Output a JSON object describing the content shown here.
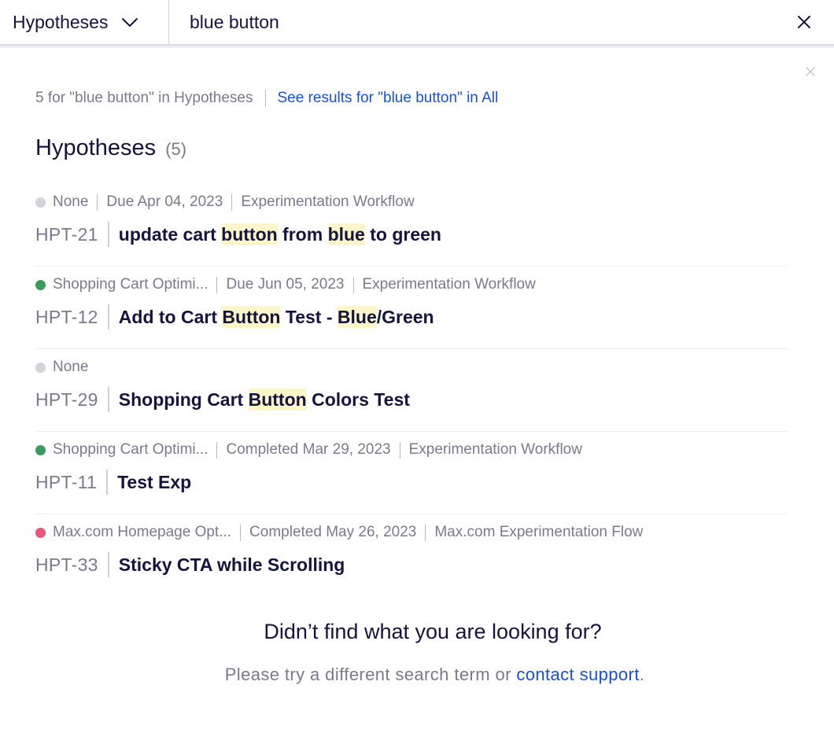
{
  "search": {
    "scope_label": "Hypotheses",
    "query": "blue button",
    "icons": {
      "scope_toggle": "chevron-down-icon",
      "clear": "close-icon"
    }
  },
  "panel": {
    "close_icon": "close-icon",
    "summary": "5 for \"blue button\" in Hypotheses",
    "see_all_link": "See results for \"blue button\" in All",
    "section_title": "Hypotheses",
    "section_count": "(5)"
  },
  "results": [
    {
      "status_color": "#d3d3d9",
      "meta": [
        "None",
        "Due Apr 04, 2023",
        "Experimentation Workflow"
      ],
      "id": "HPT-21",
      "title_parts": [
        {
          "text": "update cart ",
          "hl": false
        },
        {
          "text": "button",
          "hl": true
        },
        {
          "text": " from ",
          "hl": false
        },
        {
          "text": "blue",
          "hl": true
        },
        {
          "text": " to green",
          "hl": false
        }
      ]
    },
    {
      "status_color": "#3c9a5f",
      "meta": [
        "Shopping Cart Optimi...",
        "Due Jun 05, 2023",
        "Experimentation Workflow"
      ],
      "id": "HPT-12",
      "title_parts": [
        {
          "text": "Add to Cart ",
          "hl": false
        },
        {
          "text": "Button",
          "hl": true
        },
        {
          "text": " Test - ",
          "hl": false
        },
        {
          "text": "Blue",
          "hl": true
        },
        {
          "text": "/Green",
          "hl": false
        }
      ]
    },
    {
      "status_color": "#d3d3d9",
      "meta": [
        "None"
      ],
      "id": "HPT-29",
      "title_parts": [
        {
          "text": "Shopping Cart ",
          "hl": false
        },
        {
          "text": "Button",
          "hl": true
        },
        {
          "text": " Colors Test",
          "hl": false
        }
      ]
    },
    {
      "status_color": "#3c9a5f",
      "meta": [
        "Shopping Cart Optimi...",
        "Completed Mar 29, 2023",
        "Experimentation Workflow"
      ],
      "id": "HPT-11",
      "title_parts": [
        {
          "text": "Test Exp",
          "hl": false
        }
      ]
    },
    {
      "status_color": "#e8577a",
      "meta": [
        "Max.com Homepage Opt...",
        "Completed May 26, 2023",
        "Max.com Experimentation Flow"
      ],
      "id": "HPT-33",
      "title_parts": [
        {
          "text": "Sticky CTA while Scrolling",
          "hl": false
        }
      ]
    }
  ],
  "footer": {
    "question": "Didn’t find what you are looking for?",
    "help_prefix": "Please try a different search term or ",
    "help_link": "contact support",
    "help_suffix": "."
  },
  "colors": {
    "text": "#14143c",
    "muted": "#7a7a8c",
    "link": "#1b4fd8",
    "highlight": "#fdf6cb"
  }
}
